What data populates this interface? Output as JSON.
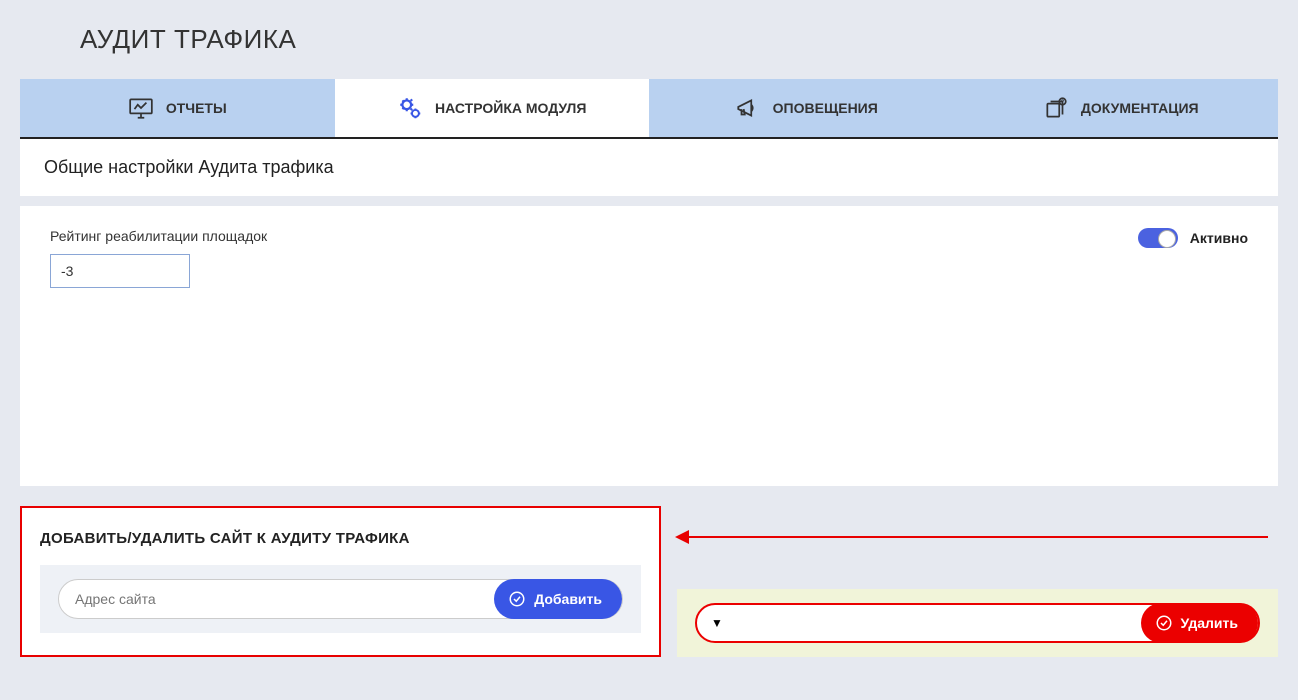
{
  "page": {
    "title": "АУДИТ ТРАФИКА"
  },
  "tabs": {
    "reports": "ОТЧЕТЫ",
    "settings": "НАСТРОЙКА МОДУЛЯ",
    "notifications": "ОПОВЕЩЕНИЯ",
    "docs": "ДОКУМЕНТАЦИЯ"
  },
  "section": {
    "header": "Общие настройки Аудита трафика"
  },
  "rating": {
    "label": "Рейтинг реабилитации площадок",
    "value": "-3"
  },
  "toggle": {
    "label": "Активно"
  },
  "add_section": {
    "title": "ДОБАВИТЬ/УДАЛИТЬ САЙТ К АУДИТУ ТРАФИКА",
    "placeholder": "Адрес сайта",
    "button": "Добавить"
  },
  "remove_section": {
    "button": "Удалить"
  }
}
